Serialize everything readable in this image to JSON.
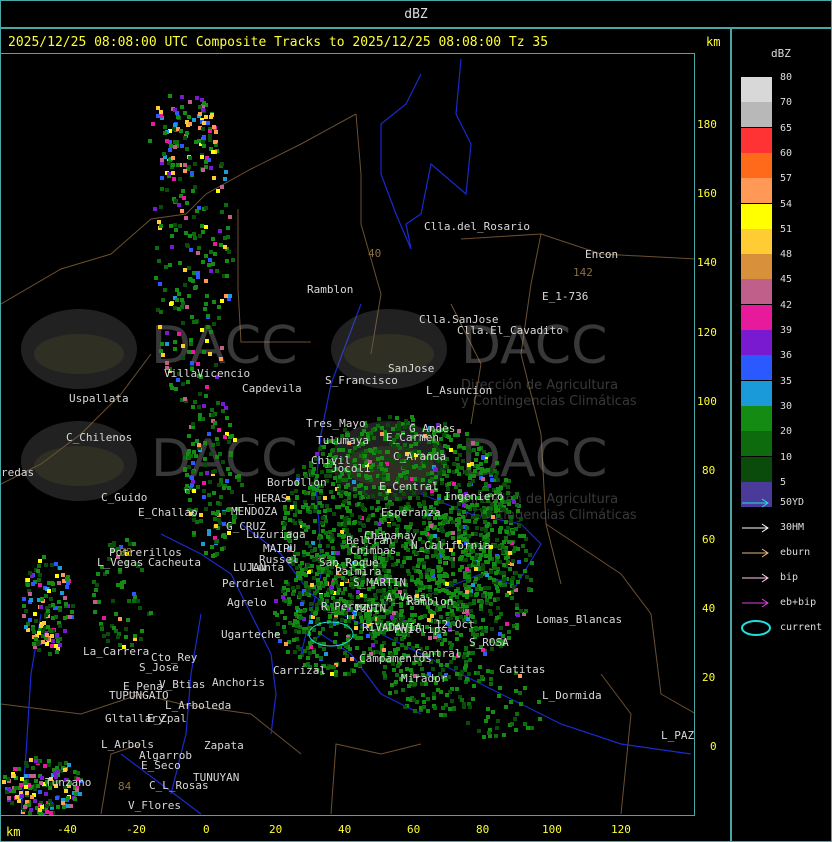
{
  "top_title": "dBZ",
  "header": "2025/12/25 08:08:00 UTC Composite Tracks to 2025/12/25 08:08:00 Tz 35",
  "units": "km",
  "y_ticks": [
    "180",
    "160",
    "140",
    "120",
    "100",
    "80",
    "60",
    "40",
    "20",
    "0"
  ],
  "x_ticks": [
    "-40",
    "-20",
    "0",
    "20",
    "40",
    "60",
    "80",
    "100",
    "120"
  ],
  "legend": {
    "title": "dBZ",
    "levels": [
      {
        "label": "80",
        "color": "#d8d8d8"
      },
      {
        "label": "70",
        "color": "#b8b8b8"
      },
      {
        "label": "65",
        "color": "#ff3333"
      },
      {
        "label": "60",
        "color": "#ff6a1a"
      },
      {
        "label": "57",
        "color": "#ff9955"
      },
      {
        "label": "54",
        "color": "#ffff00"
      },
      {
        "label": "51",
        "color": "#ffcc33"
      },
      {
        "label": "48",
        "color": "#d9903a"
      },
      {
        "label": "45",
        "color": "#c0608a"
      },
      {
        "label": "42",
        "color": "#e61a9a"
      },
      {
        "label": "39",
        "color": "#7a1ad0"
      },
      {
        "label": "36",
        "color": "#2a5aff"
      },
      {
        "label": "35",
        "color": "#1a9ad8"
      },
      {
        "label": "30",
        "color": "#148c14"
      },
      {
        "label": "20",
        "color": "#0d6a0d"
      },
      {
        "label": "10",
        "color": "#0a4a0a"
      },
      {
        "label": "5",
        "color": "#4a3a9a"
      }
    ],
    "tracks": [
      {
        "label": "50YD",
        "color": "#22dddd",
        "shape": "arrow"
      },
      {
        "label": "30HM",
        "color": "#ffffff",
        "shape": "arrow"
      },
      {
        "label": "eburn",
        "color": "#e6b87a",
        "shape": "arrow"
      },
      {
        "label": "bip",
        "color": "#ffccee",
        "shape": "arrow"
      },
      {
        "label": "eb+bip",
        "color": "#dd44dd",
        "shape": "arrow"
      },
      {
        "label": "current",
        "color": "#22dddd",
        "shape": "ellipse"
      }
    ]
  },
  "watermark": {
    "brand": "DACC",
    "line1": "Dirección de Agricultura",
    "line2": "y Contingencias Climáticas"
  },
  "places": [
    {
      "name": "Clla.del_Rosario"
    },
    {
      "name": "Encon"
    },
    {
      "name": "E_1-736"
    },
    {
      "name": "Ramblon"
    },
    {
      "name": "Clla.SanJose"
    },
    {
      "name": "Clla.El_Cavadito"
    },
    {
      "name": "VillaVicencio"
    },
    {
      "name": "Capdevila"
    },
    {
      "name": "S_Francisco"
    },
    {
      "name": "SanJose"
    },
    {
      "name": "L_Asuncion"
    },
    {
      "name": "Uspallata"
    },
    {
      "name": "Tres_Mayo"
    },
    {
      "name": "Tulumaya"
    },
    {
      "name": "E_Carmen"
    },
    {
      "name": "G_Andes"
    },
    {
      "name": "C_Chilenos"
    },
    {
      "name": "C_Guido"
    },
    {
      "name": "L_HERAS"
    },
    {
      "name": "MENDOZA"
    },
    {
      "name": "G_CRUZ"
    },
    {
      "name": "Luzuriaga"
    },
    {
      "name": "E_Challao"
    },
    {
      "name": "Chapanay"
    },
    {
      "name": "Potrerillos"
    },
    {
      "name": "L_Vegas"
    },
    {
      "name": "Cacheuta"
    },
    {
      "name": "MAIPU"
    },
    {
      "name": "Russel"
    },
    {
      "name": "LUJAN"
    },
    {
      "name": "Perdriel"
    },
    {
      "name": "Chimbas"
    },
    {
      "name": "S_MARTIN"
    },
    {
      "name": "Agrelo"
    },
    {
      "name": "Ugarteche"
    },
    {
      "name": "R_Perez"
    },
    {
      "name": "JUNIN"
    },
    {
      "name": "RIVADAVIA"
    },
    {
      "name": "A_Vera"
    },
    {
      "name": "Ramblon"
    },
    {
      "name": "Lomas_Blancas"
    },
    {
      "name": "La_Carrera"
    },
    {
      "name": "Cto_Rey"
    },
    {
      "name": "S_Jose"
    },
    {
      "name": "E_Pena"
    },
    {
      "name": "TUPUNGATO"
    },
    {
      "name": "V_Btias"
    },
    {
      "name": "Anchoris"
    },
    {
      "name": "Carrizal"
    },
    {
      "name": "Campamentos"
    },
    {
      "name": "Mirador"
    },
    {
      "name": "Catitas"
    },
    {
      "name": "L_Dormida"
    },
    {
      "name": "L_PAZ"
    },
    {
      "name": "Gltallary"
    },
    {
      "name": "E_Zpal"
    },
    {
      "name": "L_Arboleda"
    },
    {
      "name": "L_Arbols"
    },
    {
      "name": "Algarrob"
    },
    {
      "name": "Zapata"
    },
    {
      "name": "E_Seco"
    },
    {
      "name": "C_L_Rosas"
    },
    {
      "name": "TUNUYAN"
    },
    {
      "name": "V_Flores"
    },
    {
      "name": "Tunzano"
    },
    {
      "name": "S_ROSA"
    },
    {
      "name": "12_Oct"
    },
    {
      "name": "Phillips"
    },
    {
      "name": "Central"
    },
    {
      "name": "Beltran"
    },
    {
      "name": "C_Aranda"
    },
    {
      "name": "Esperanza"
    },
    {
      "name": "Ingeniero"
    },
    {
      "name": "Chivil"
    },
    {
      "name": "Jocoli"
    },
    {
      "name": "Borbollon"
    },
    {
      "name": "Lunta"
    },
    {
      "name": "San_Roque"
    },
    {
      "name": "Palmira"
    },
    {
      "name": "N_California"
    },
    {
      "name": "E_Central"
    },
    {
      "name": "redas"
    }
  ],
  "annotations": [
    "142",
    "88",
    "84",
    "40"
  ]
}
